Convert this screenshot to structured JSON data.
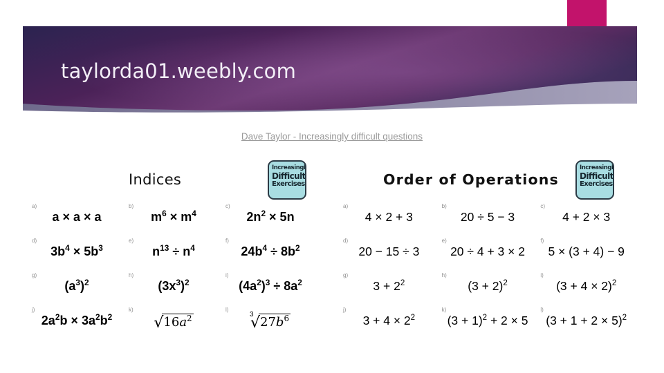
{
  "banner": {
    "title": "taylorda01.weebly.com",
    "colors": {
      "purple_dark": "#2b2350",
      "purple_mid": "#5c2a63",
      "purple_light": "#7a4a86",
      "accent_pink": "#c2136b",
      "wedge_gray": "#8f8aa8"
    }
  },
  "subtitle": {
    "text": "Dave Taylor - Increasingly difficult questions"
  },
  "logo": {
    "line1": "Increasingly",
    "line2": "Difficult",
    "line3": "Exercises",
    "bg_color": "#a8dde2",
    "border_color": "#2b3a45"
  },
  "worksheets": [
    {
      "title": "Indices",
      "questions": [
        {
          "label": "a)",
          "expr_html": "a × a × a"
        },
        {
          "label": "b)",
          "expr_html": "m<sup>6</sup> × m<sup>4</sup>"
        },
        {
          "label": "c)",
          "expr_html": "2n<sup>2</sup> × 5n"
        },
        {
          "label": "d)",
          "expr_html": "3b<sup>4</sup> × 5b<sup>3</sup>"
        },
        {
          "label": "e)",
          "expr_html": "n<sup>13</sup> ÷ n<sup>4</sup>"
        },
        {
          "label": "f)",
          "expr_html": "24b<sup>4</sup> ÷ 8b<sup>2</sup>"
        },
        {
          "label": "g)",
          "expr_html": "(a<sup>3</sup>)<sup>2</sup>"
        },
        {
          "label": "h)",
          "expr_html": "(3x<sup>3</sup>)<sup>2</sup>"
        },
        {
          "label": "i)",
          "expr_html": "(4a<sup>2</sup>)<sup>3</sup> ÷ 8a<sup>2</sup>"
        },
        {
          "label": "j)",
          "expr_html": "2a<sup>2</sup>b × 3a<sup>2</sup>b<sup>2</sup>"
        },
        {
          "label": "k)",
          "expr_html": "<span class=\"rad\"><span class=\"sign\">√</span><span class=\"body\"><span class=\"num\">16</span><span class=\"var\">a</span><sup class=\"num\">2</sup></span></span>"
        },
        {
          "label": "l)",
          "expr_html": "<span class=\"rad\"><span class=\"idx\">3</span><span class=\"sign\">√</span><span class=\"body\"><span class=\"num\">27</span><span class=\"var\">b</span><sup class=\"num\">6</sup></span></span>"
        }
      ]
    },
    {
      "title": "Order of Operations",
      "questions": [
        {
          "label": "a)",
          "expr_html": "4 × 2 + 3"
        },
        {
          "label": "b)",
          "expr_html": "20 ÷ 5 − 3"
        },
        {
          "label": "c)",
          "expr_html": "4 + 2 × 3"
        },
        {
          "label": "d)",
          "expr_html": "20 − 15 ÷ 3"
        },
        {
          "label": "e)",
          "expr_html": "20 ÷ 4 + 3 × 2"
        },
        {
          "label": "f)",
          "expr_html": "5 × (3 + 4) − 9"
        },
        {
          "label": "g)",
          "expr_html": "3 + 2<sup>2</sup>"
        },
        {
          "label": "h)",
          "expr_html": "(3 + 2)<sup>2</sup>"
        },
        {
          "label": "i)",
          "expr_html": "(3 + 4 × 2)<sup>2</sup>"
        },
        {
          "label": "j)",
          "expr_html": "3 + 4 × 2<sup>2</sup>"
        },
        {
          "label": "k)",
          "expr_html": "(3 + 1)<sup>2</sup> + 2 × 5"
        },
        {
          "label": "l)",
          "expr_html": "(3 + 1 + 2 × 5)<sup>2</sup>"
        }
      ]
    }
  ]
}
